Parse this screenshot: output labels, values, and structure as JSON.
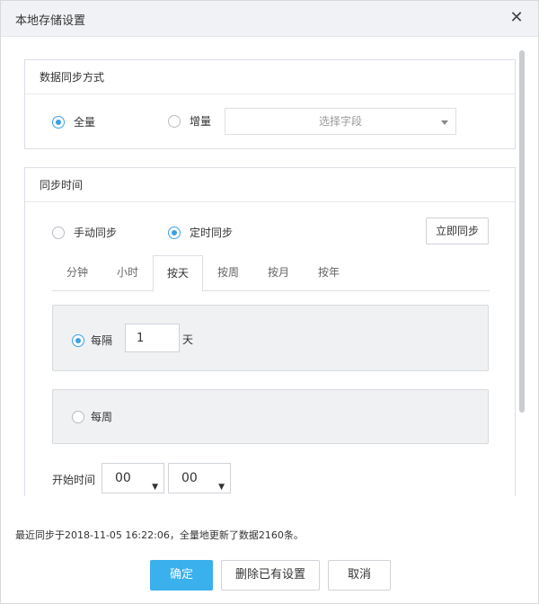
{
  "dialog": {
    "title": "本地存储设置",
    "close_icon": "close-icon"
  },
  "sync_method": {
    "header": "数据同步方式",
    "options": [
      {
        "label": "全量",
        "selected": true
      },
      {
        "label": "增量",
        "selected": false
      }
    ],
    "field_select": {
      "placeholder": "选择字段"
    }
  },
  "sync_time": {
    "header": "同步时间",
    "modes": [
      {
        "label": "手动同步",
        "selected": false
      },
      {
        "label": "定时同步",
        "selected": true
      }
    ],
    "sync_now_label": "立即同步",
    "tabs": [
      {
        "label": "分钟",
        "active": false
      },
      {
        "label": "小时",
        "active": false
      },
      {
        "label": "按天",
        "active": true
      },
      {
        "label": "按周",
        "active": false
      },
      {
        "label": "按月",
        "active": false
      },
      {
        "label": "按年",
        "active": false
      }
    ],
    "every_interval": {
      "label": "每隔",
      "value": "1",
      "unit": "天",
      "selected": true
    },
    "weekly": {
      "label": "每周",
      "selected": false
    },
    "start_time": {
      "label": "开始时间",
      "hour": "00",
      "minute": "00"
    }
  },
  "footer": {
    "last_sync_info": "最近同步于2018-11-05 16:22:06，全量地更新了数据2160条。",
    "confirm_label": "确定",
    "delete_label": "删除已有设置",
    "cancel_label": "取消"
  },
  "colors": {
    "accent": "#3ab0ec",
    "radio_on": "#3aa0e8"
  }
}
